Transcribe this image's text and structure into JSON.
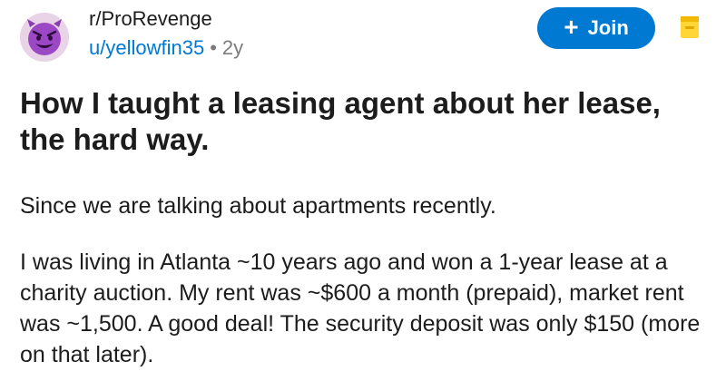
{
  "header": {
    "subreddit": "r/ProRevenge",
    "username": "u/yellowfin35",
    "separator": "•",
    "age": "2y",
    "avatar_icon": "devil-face-icon",
    "join_label": "Join",
    "join_icon": "plus-icon",
    "save_icon": "bookmark-icon"
  },
  "post": {
    "title": "How I taught a leasing agent about her lease, the hard way.",
    "paragraphs": [
      "Since we are talking about apartments recently.",
      "I was living in Atlanta ~10 years ago and won a 1-year lease at a charity auction.  My rent was ~$600 a month (prepaid), market rent was ~1,500.  A good deal!  The security deposit was only $150 (more on that later)."
    ]
  },
  "colors": {
    "accent": "#0079d3",
    "save_icon": "#ffd635",
    "avatar_bg": "#e9d3e7",
    "text": "#1c1c1c",
    "muted": "#7c7c7c"
  }
}
